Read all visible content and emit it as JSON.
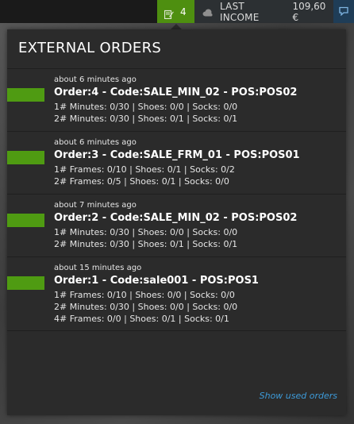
{
  "topbar": {
    "orders_count": "4",
    "income_label": "LAST INCOME",
    "income_value": "109,60 €",
    "accent_green": "#4e8f10",
    "accent_blue": "#1f3d57"
  },
  "panel": {
    "title": "EXTERNAL ORDERS",
    "show_used_label": "Show used orders",
    "link_color": "#3d9ad8",
    "status_color": "#4f9b12"
  },
  "orders": [
    {
      "time": "about 6 minutes ago",
      "title": "Order:4 - Code:SALE_MIN_02 - POS:POS02",
      "lines": [
        "1# Minutes: 0/30 | Shoes: 0/0 | Socks: 0/0",
        "2# Minutes: 0/30 | Shoes: 0/1 | Socks: 0/1"
      ]
    },
    {
      "time": "about 6 minutes ago",
      "title": "Order:3 - Code:SALE_FRM_01 - POS:POS01",
      "lines": [
        "1# Frames: 0/10 | Shoes: 0/1 | Socks: 0/2",
        "2# Frames: 0/5 | Shoes: 0/1 | Socks: 0/0"
      ]
    },
    {
      "time": "about 7 minutes ago",
      "title": "Order:2 - Code:SALE_MIN_02 - POS:POS02",
      "lines": [
        "1# Minutes: 0/30 | Shoes: 0/0 | Socks: 0/0",
        "2# Minutes: 0/30 | Shoes: 0/1 | Socks: 0/1"
      ]
    },
    {
      "time": "about 15 minutes ago",
      "title": "Order:1 - Code:sale001 - POS:POS1",
      "lines": [
        "1# Frames: 0/10 | Shoes: 0/0 | Socks: 0/0",
        "2# Minutes: 0/30 | Shoes: 0/0 | Socks: 0/0",
        "4# Frames: 0/0 | Shoes: 0/1 | Socks: 0/1"
      ]
    }
  ]
}
